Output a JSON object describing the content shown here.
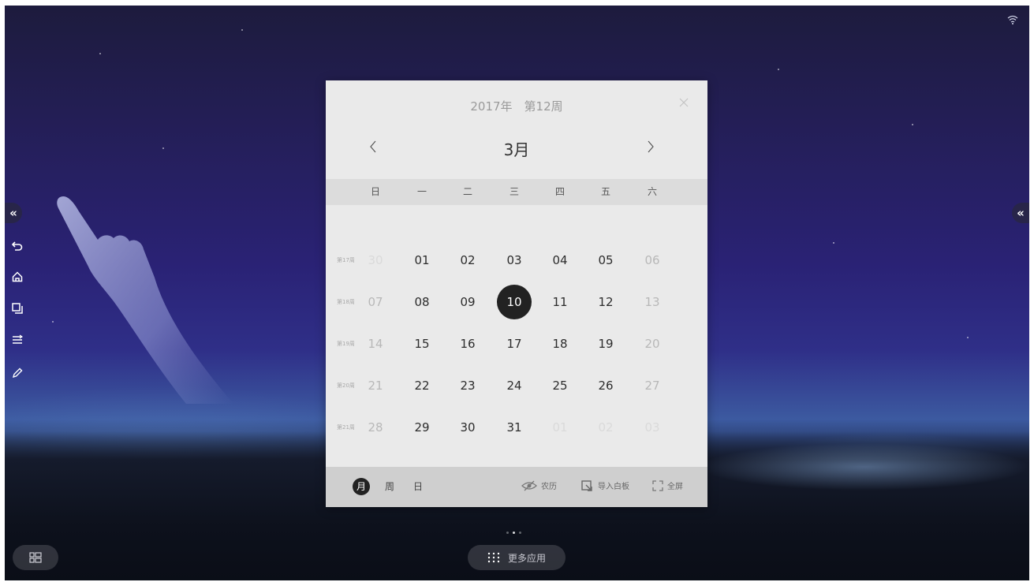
{
  "calendar": {
    "year_week": "2017年　第12周",
    "month": "3月",
    "weekdays": [
      "日",
      "一",
      "二",
      "三",
      "四",
      "五",
      "六"
    ],
    "weeks": [
      {
        "label": "第17周",
        "days": [
          "30",
          "01",
          "02",
          "03",
          "04",
          "05",
          "06"
        ]
      },
      {
        "label": "第18周",
        "days": [
          "07",
          "08",
          "09",
          "10",
          "11",
          "12",
          "13"
        ]
      },
      {
        "label": "第19周",
        "days": [
          "14",
          "15",
          "16",
          "17",
          "18",
          "19",
          "20"
        ]
      },
      {
        "label": "第20周",
        "days": [
          "21",
          "22",
          "23",
          "24",
          "25",
          "26",
          "27"
        ]
      },
      {
        "label": "第21周",
        "days": [
          "28",
          "29",
          "30",
          "31",
          "01",
          "02",
          "03"
        ]
      }
    ],
    "selected_day": "10",
    "view_modes": [
      "月",
      "周",
      "日"
    ],
    "active_view": "月",
    "actions": {
      "lunar": "农历",
      "import_whiteboard": "导入白板",
      "fullscreen": "全屏"
    }
  },
  "taskbar": {
    "more_apps": "更多应用"
  },
  "icons": {
    "close": "close-icon",
    "prev": "chevron-left-icon",
    "next": "chevron-right-icon",
    "wifi": "wifi-icon",
    "undo": "undo-icon",
    "home": "home-icon",
    "windows": "windows-icon",
    "menu": "menu-icon",
    "pen": "pen-icon",
    "apps": "apps-grid-icon",
    "start": "start-icon",
    "eye_off": "eye-off-icon",
    "import": "import-icon",
    "expand": "expand-icon"
  }
}
